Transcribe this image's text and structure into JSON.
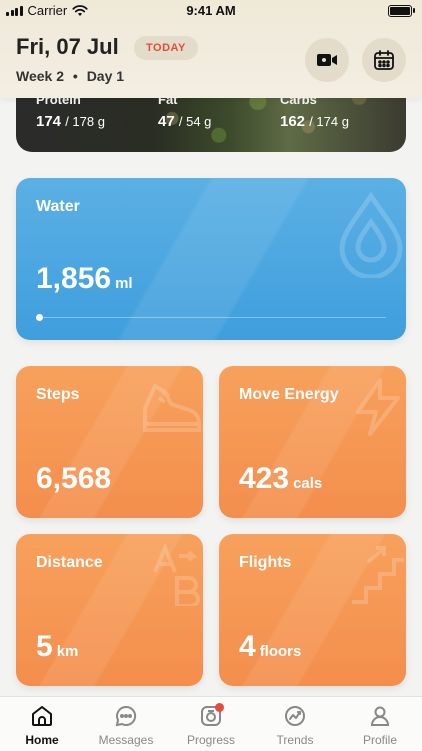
{
  "status": {
    "carrier": "Carrier",
    "time": "9:41 AM"
  },
  "header": {
    "date": "Fri, 07 Jul",
    "today_badge": "TODAY",
    "week": "Week 2",
    "separator": "•",
    "day": "Day 1",
    "video_icon": "video-camera-icon",
    "calendar_icon": "calendar-icon"
  },
  "macros": {
    "protein": {
      "label": "Protein",
      "value": "174",
      "target": "/ 178 g"
    },
    "fat": {
      "label": "Fat",
      "value": "47",
      "target": "/ 54 g"
    },
    "carbs": {
      "label": "Carbs",
      "value": "162",
      "target": "/ 174 g"
    }
  },
  "water": {
    "title": "Water",
    "value": "1,856",
    "unit": "ml",
    "progress": 0.0,
    "icon": "water-drop-icon"
  },
  "steps": {
    "title": "Steps",
    "value": "6,568",
    "unit": "",
    "icon": "sneaker-icon"
  },
  "move_energy": {
    "title": "Move Energy",
    "value": "423",
    "unit": "cals",
    "icon": "lightning-icon"
  },
  "distance": {
    "title": "Distance",
    "value": "5",
    "unit": "km",
    "icon": "a-to-b-icon"
  },
  "flights": {
    "title": "Flights",
    "value": "4",
    "unit": "floors",
    "icon": "stairs-icon"
  },
  "tabs": [
    {
      "label": "Home",
      "icon": "home-icon",
      "active": true
    },
    {
      "label": "Messages",
      "icon": "chat-bubble-icon",
      "active": false
    },
    {
      "label": "Progress",
      "icon": "camera-icon",
      "active": false,
      "badge": true
    },
    {
      "label": "Trends",
      "icon": "trend-chart-icon",
      "active": false
    },
    {
      "label": "Profile",
      "icon": "person-icon",
      "active": false
    }
  ],
  "colors": {
    "water": "#4aa7e0",
    "orange": "#f59a55",
    "today_text": "#e34c3a",
    "badge": "#e84b3c"
  }
}
